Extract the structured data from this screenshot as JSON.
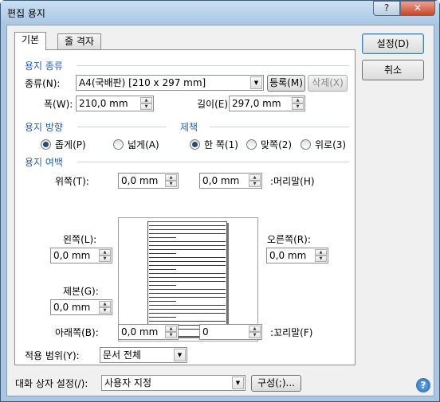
{
  "window": {
    "title": "편집 용지",
    "help": "?",
    "close": "✕"
  },
  "tabs": [
    {
      "label": "기본"
    },
    {
      "label": "줄 격자"
    }
  ],
  "paper_type": {
    "section": "용지 종류",
    "kind_label": "종류(N):",
    "kind_value": "A4(국배판)  [210 x 297 mm]",
    "register": "등록(M)",
    "delete": "삭제(X)",
    "width_label": "폭(W):",
    "width_value": "210,0 mm",
    "length_label": "길이(E):",
    "length_value": "297,0 mm"
  },
  "orientation": {
    "section": "용지 방향",
    "portrait": "좁게(P)",
    "landscape": "넓게(A)",
    "selected": "portrait"
  },
  "binding": {
    "section": "제책",
    "one_side": "한 쪽(1)",
    "facing": "맞쪽(2)",
    "top": "위로(3)",
    "selected": "one_side"
  },
  "margins": {
    "section": "용지 여백",
    "top_label": "위쪽(T):",
    "top_value": "0,0 mm",
    "header_label": ":머리말(H)",
    "header_value": "0,0 mm",
    "left_label": "왼쪽(L):",
    "left_value": "0,0 mm",
    "right_label": "오른쪽(R):",
    "right_value": "0,0 mm",
    "gutter_label": "제본(G):",
    "gutter_value": "0,0 mm",
    "bottom_label": "아래쪽(B):",
    "bottom_value": "0,0 mm",
    "footer_label": ":꼬리말(F)",
    "footer_value": "0"
  },
  "scope": {
    "label": "적용 범위(Y):",
    "value": "문서 전체"
  },
  "dialog_settings": {
    "label": "대화 상자 설정(/):",
    "value": "사용자 지정",
    "configure": "구성(;)..."
  },
  "buttons": {
    "ok": "설정(D)",
    "cancel": "취소"
  }
}
